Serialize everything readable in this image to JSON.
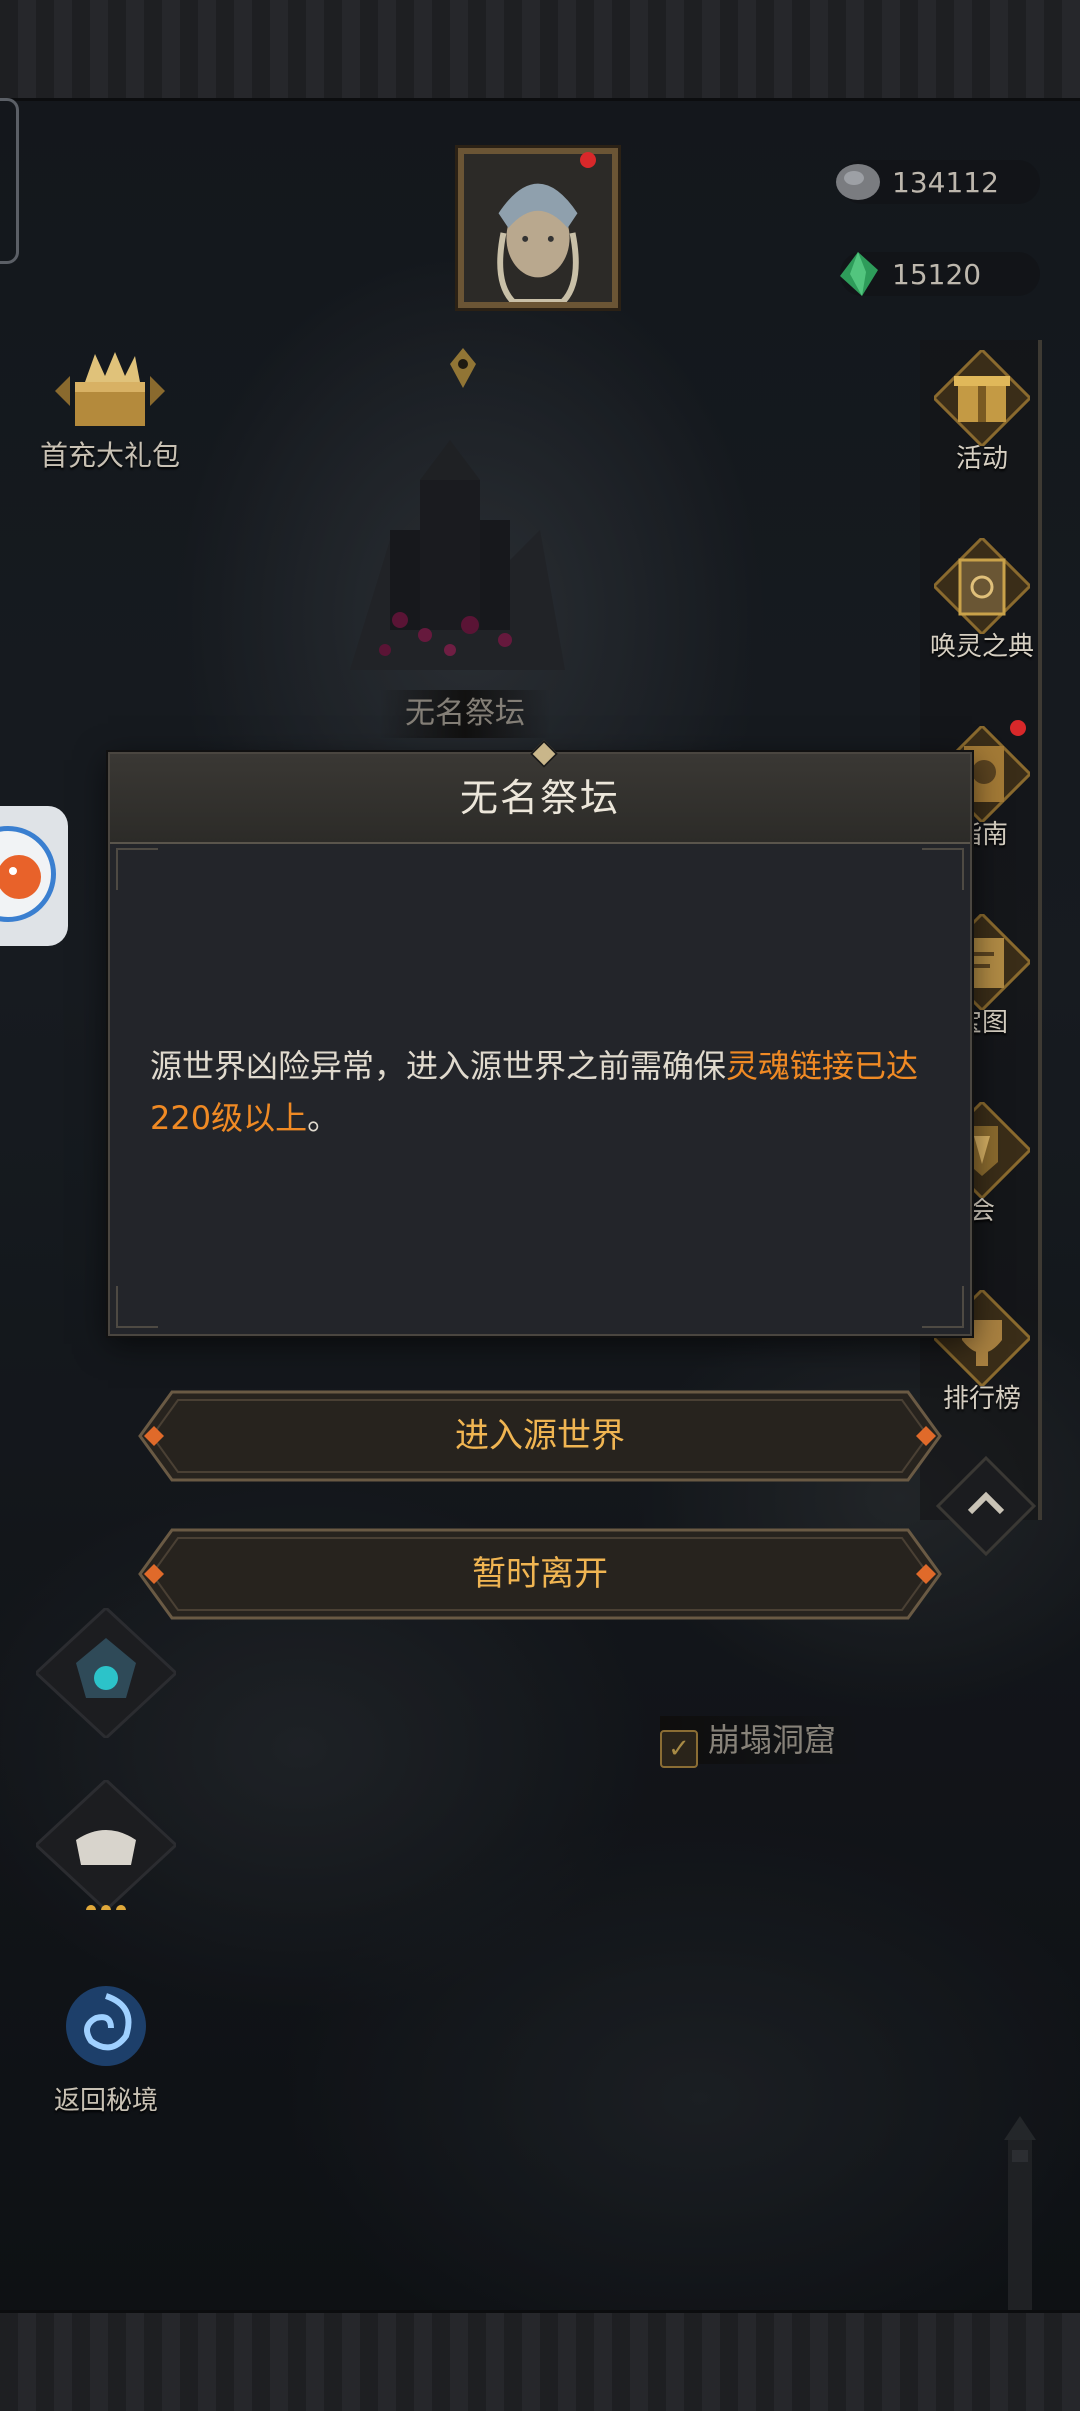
{
  "resources": {
    "coin": {
      "icon": "ore-coin-icon",
      "value": "134112"
    },
    "gem": {
      "icon": "green-gem-icon",
      "value": "15120"
    }
  },
  "left_menu": {
    "first_recharge": "首充大礼包",
    "return_secret_realm": "返回秘境"
  },
  "right_menu": {
    "items": [
      {
        "label": "活动",
        "icon": "gift-icon"
      },
      {
        "label": "唤灵之典",
        "icon": "book-icon"
      },
      {
        "label": "指南",
        "icon": "guide-icon"
      },
      {
        "label": "宝图",
        "icon": "treasure-map-icon"
      },
      {
        "label": "会",
        "icon": "guild-icon"
      },
      {
        "label": "排行榜",
        "icon": "ranking-icon"
      }
    ]
  },
  "map": {
    "location_label": "无名祭坛",
    "cave_label": "崩塌洞窟"
  },
  "dialog": {
    "title": "无名祭坛",
    "body_prefix": "源世界凶险异常，进入源世界之前需确保",
    "body_highlight": "灵魂链接已达220级以上",
    "body_suffix": "。",
    "highlight_color": "#f08a24"
  },
  "buttons": {
    "enter": "进入源世界",
    "leave": "暂时离开"
  }
}
